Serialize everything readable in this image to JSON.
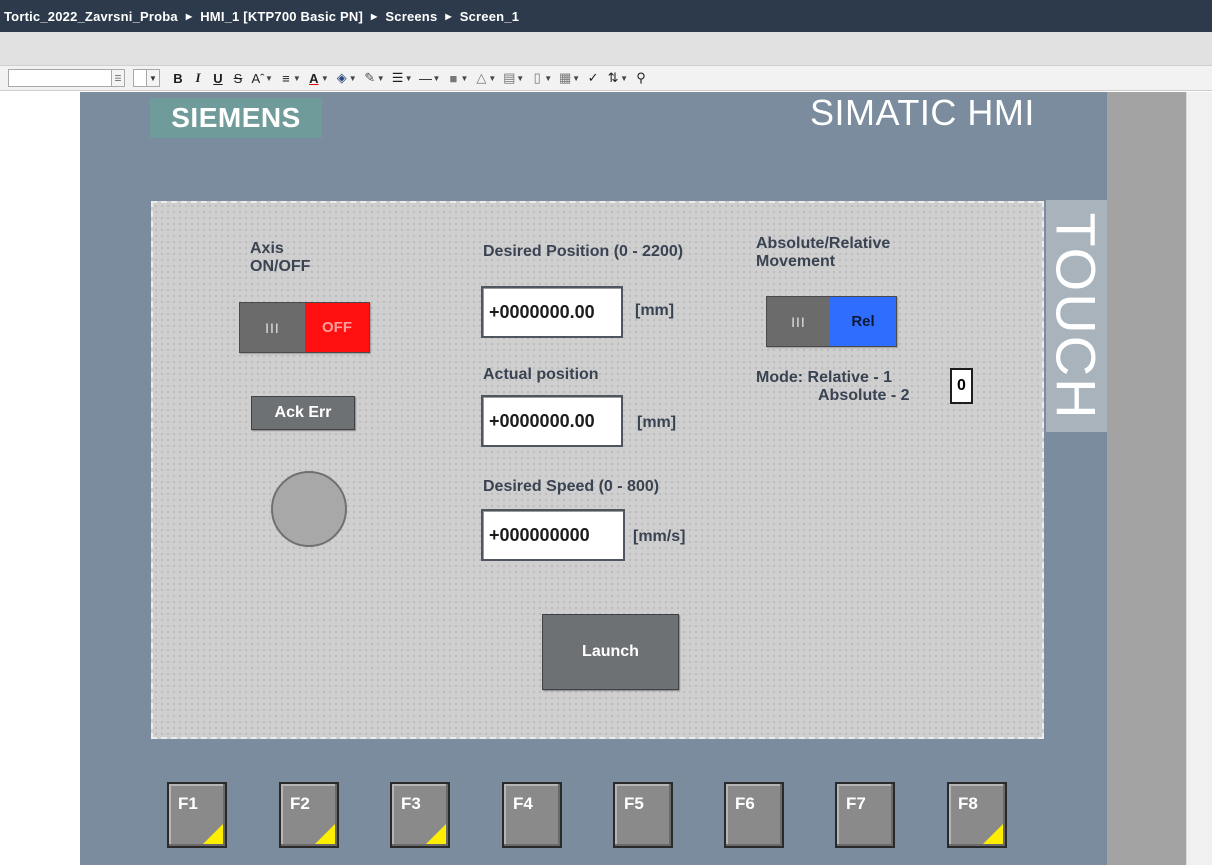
{
  "breadcrumb": {
    "items": [
      "Tortic_2022_Zavrsni_Proba",
      "HMI_1 [KTP700 Basic PN]",
      "Screens",
      "Screen_1"
    ]
  },
  "toolbar": {
    "bold": "B",
    "italic": "I",
    "underline": "U",
    "strike": "S"
  },
  "device": {
    "brand": "SIEMENS",
    "model": "SIMATIC HMI",
    "touch": "TOUCH"
  },
  "screen": {
    "axis_label_line1": "Axis",
    "axis_label_line2": "ON/OFF",
    "axis_toggle": {
      "grip": "III",
      "state": "OFF",
      "state_color": "#ff1010"
    },
    "ack_button": "Ack Err",
    "desired_position_label": "Desired Position (0 - 2200)",
    "desired_position_value": "+0000000.00",
    "desired_position_unit": "[mm]",
    "actual_position_label": "Actual position",
    "actual_position_value": "+0000000.00",
    "actual_position_unit": "[mm]",
    "desired_speed_label": "Desired Speed (0 - 800)",
    "desired_speed_value": "+000000000",
    "desired_speed_unit": "[mm/s]",
    "absrel_label_line1": "Absolute/Relative",
    "absrel_label_line2": "Movement",
    "absrel_toggle": {
      "grip": "III",
      "state": "Rel",
      "state_color": "#2f6dff"
    },
    "mode_line1": "Mode: Relative - 1",
    "mode_line2": "Absolute - 2",
    "mode_value": "0",
    "launch_button": "Launch"
  },
  "function_keys": [
    "F1",
    "F2",
    "F3",
    "F4",
    "F5",
    "F6",
    "F7",
    "F8"
  ]
}
